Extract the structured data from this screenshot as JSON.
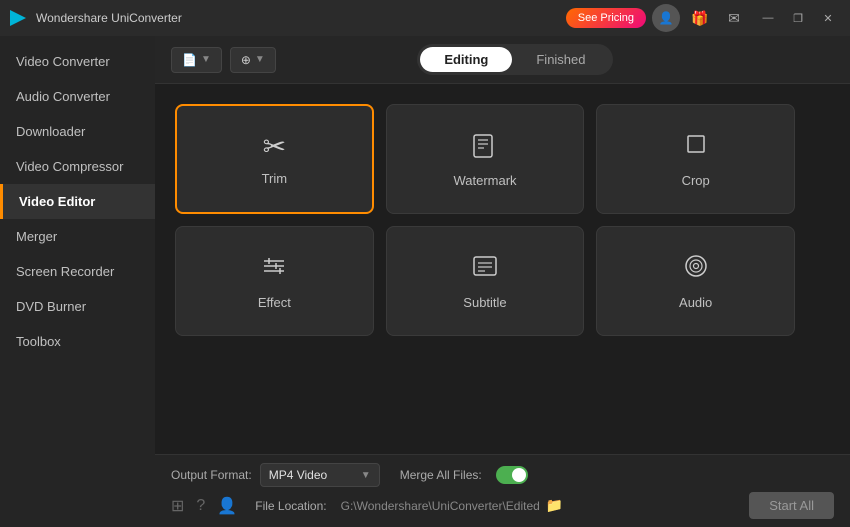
{
  "app": {
    "title": "Wondershare UniConverter",
    "logo_icon": "▶",
    "pricing_btn": "See Pricing"
  },
  "titlebar": {
    "icons": [
      "👤",
      "🎁",
      "✉"
    ],
    "window_controls": [
      "—",
      "❐",
      "✕"
    ]
  },
  "sidebar": {
    "items": [
      {
        "label": "Video Converter",
        "id": "video-converter",
        "active": false
      },
      {
        "label": "Audio Converter",
        "id": "audio-converter",
        "active": false
      },
      {
        "label": "Downloader",
        "id": "downloader",
        "active": false
      },
      {
        "label": "Video Compressor",
        "id": "video-compressor",
        "active": false
      },
      {
        "label": "Video Editor",
        "id": "video-editor",
        "active": true
      },
      {
        "label": "Merger",
        "id": "merger",
        "active": false
      },
      {
        "label": "Screen Recorder",
        "id": "screen-recorder",
        "active": false
      },
      {
        "label": "DVD Burner",
        "id": "dvd-burner",
        "active": false
      },
      {
        "label": "Toolbox",
        "id": "toolbox",
        "active": false
      }
    ]
  },
  "toolbar": {
    "add_btn_icon": "📄",
    "qr_btn_icon": "⊕",
    "tabs": [
      {
        "label": "Editing",
        "active": true
      },
      {
        "label": "Finished",
        "active": false
      }
    ]
  },
  "tools": [
    {
      "id": "trim",
      "label": "Trim",
      "icon": "✂",
      "selected": true
    },
    {
      "id": "watermark",
      "label": "Watermark",
      "icon": "🗒",
      "selected": false
    },
    {
      "id": "crop",
      "label": "Crop",
      "icon": "⬜",
      "selected": false
    },
    {
      "id": "effect",
      "label": "Effect",
      "icon": "≡",
      "selected": false
    },
    {
      "id": "subtitle",
      "label": "Subtitle",
      "icon": "🗎",
      "selected": false
    },
    {
      "id": "audio",
      "label": "Audio",
      "icon": "◎",
      "selected": false
    }
  ],
  "bottom": {
    "output_format_label": "Output Format:",
    "output_format_value": "MP4 Video",
    "merge_label": "Merge All Files:",
    "merge_on": false,
    "file_location_label": "File Location:",
    "file_path": "G:\\Wondershare\\UniConverter\\Edited",
    "start_all_btn": "Start All"
  },
  "bottom_nav": {
    "icons": [
      "⊞",
      "?",
      "👤"
    ]
  }
}
